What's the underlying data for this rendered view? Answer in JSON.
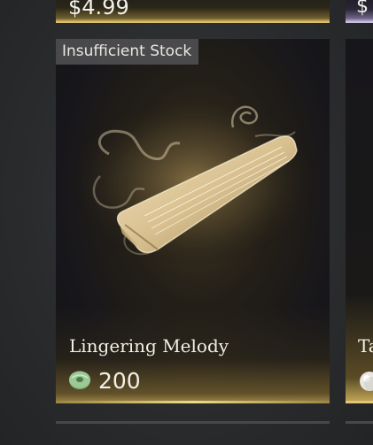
{
  "top_row": {
    "left_price": "$4.99",
    "right_price": "$"
  },
  "card": {
    "badge": "Insufficient Stock",
    "name": "Lingering Melody",
    "price": "200",
    "currency_icon": "jade-coin-icon",
    "item_icon": "guqin-zither-icon"
  },
  "side_card": {
    "name_partial": "Ta",
    "currency_icon": "pearl-icon"
  },
  "colors": {
    "gold_accent": "#d8bf6a",
    "purple_accent": "#b9aed2",
    "badge_bg": "#4e4e50",
    "jade": "#8fbf8a"
  }
}
